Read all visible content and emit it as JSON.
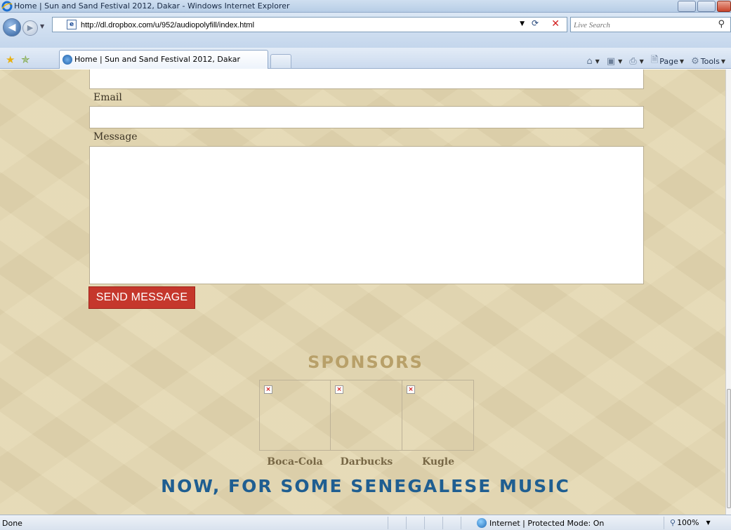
{
  "window": {
    "title": "Home | Sun and Sand Festival 2012, Dakar - Windows Internet Explorer"
  },
  "address_bar": {
    "url": "http://dl.dropbox.com/u/952/audiopolyfill/index.html",
    "search_placeholder": "Live Search"
  },
  "tabs": [
    {
      "label": "Home | Sun and Sand Festival 2012, Dakar"
    }
  ],
  "commands": {
    "page": "Page",
    "tools": "Tools"
  },
  "form": {
    "email_label": "Email",
    "email_value": "",
    "message_label": "Message",
    "message_value": "",
    "send_label": "SEND MESSAGE"
  },
  "sponsors": {
    "title": "SPONSORS",
    "items": [
      {
        "name": "Boca-Cola"
      },
      {
        "name": "Darbucks"
      },
      {
        "name": "Kugle"
      }
    ]
  },
  "music_heading": "NOW, FOR SOME SENEGALESE MUSIC",
  "status": {
    "text": "Done",
    "zone": "Internet | Protected Mode: On",
    "zoom": "100%"
  },
  "colors": {
    "page_background": "#e4d7b0",
    "send_button": "#c5372c",
    "sponsors_title": "#b8a069",
    "music_heading": "#1f5e91"
  },
  "icons": [
    "ie-logo-icon",
    "back-arrow-icon",
    "forward-arrow-icon",
    "page-icon",
    "refresh-icon",
    "stop-icon",
    "search-icon",
    "favorites-star-icon",
    "add-favorites-icon",
    "home-icon",
    "feeds-icon",
    "print-icon",
    "page-menu-icon",
    "tools-gear-icon",
    "broken-image-icon",
    "globe-icon",
    "magnifier-icon"
  ]
}
